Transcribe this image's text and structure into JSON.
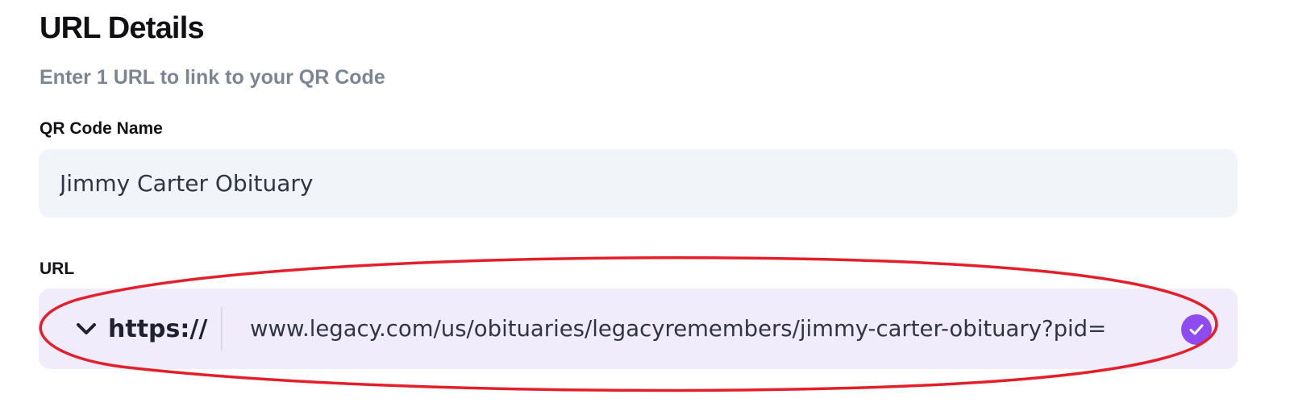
{
  "header": {
    "title": "URL Details",
    "subtitle": "Enter 1 URL to link to your QR Code"
  },
  "qr_name_field": {
    "label": "QR Code Name",
    "value": "Jimmy Carter Obituary"
  },
  "url_field": {
    "label": "URL",
    "protocol": "https://",
    "value": "www.legacy.com/us/obituaries/legacyremembers/jimmy-carter-obituary?pid=",
    "status_icon": "check-circle-icon",
    "protocol_icon": "chevron-down-icon"
  },
  "colors": {
    "accent": "#8e4cf0",
    "url_field_bg": "#f1ecfb",
    "input_bg": "#f1f4f9",
    "annotation": "#e3202a"
  }
}
